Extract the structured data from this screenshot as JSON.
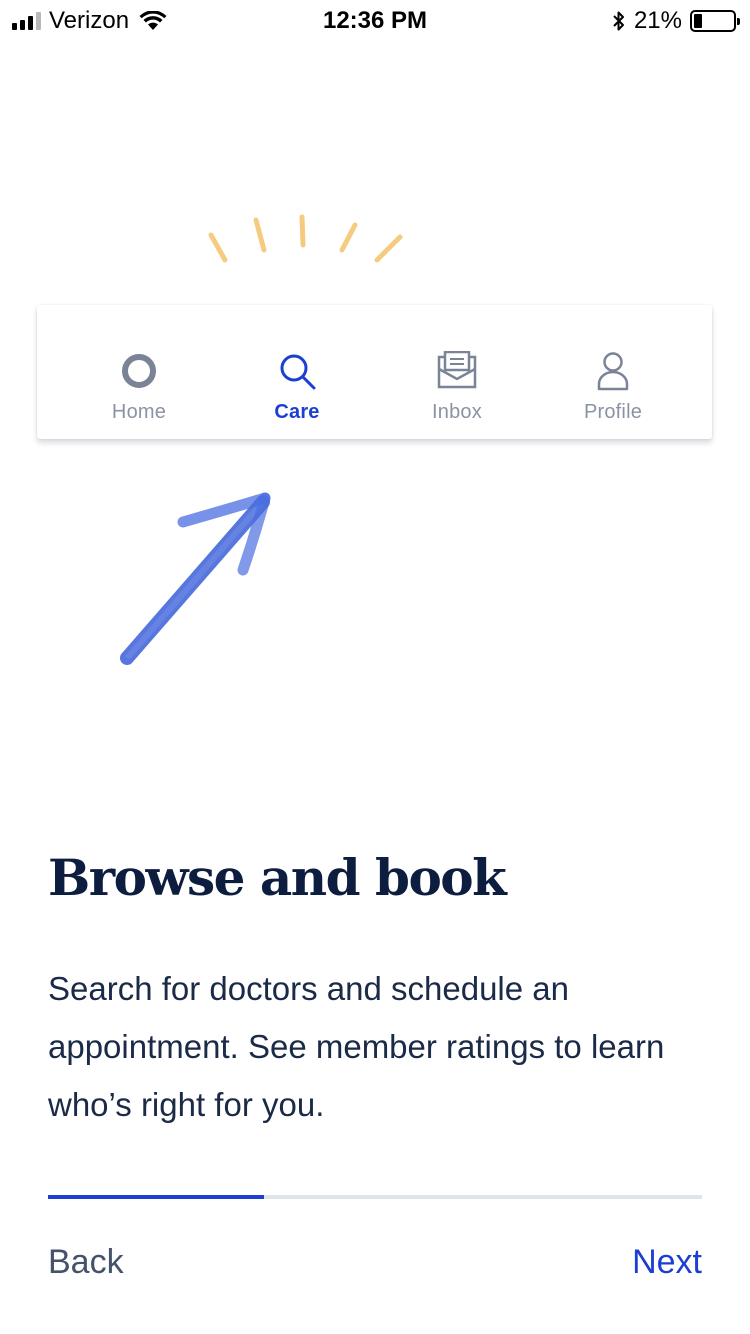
{
  "status_bar": {
    "carrier": "Verizon",
    "time": "12:36 PM",
    "battery_percent": "21%",
    "battery_level": 0.21,
    "icons": [
      "signal-icon",
      "wifi-icon",
      "bluetooth-icon",
      "battery-icon"
    ]
  },
  "illustration": {
    "tabs": [
      {
        "label": "Home",
        "icon": "home-ring-icon",
        "active": false
      },
      {
        "label": "Care",
        "icon": "search-icon",
        "active": true
      },
      {
        "label": "Inbox",
        "icon": "inbox-icon",
        "active": false
      },
      {
        "label": "Profile",
        "icon": "profile-icon",
        "active": false
      }
    ],
    "decorations": [
      "sparkle-lines",
      "hand-drawn-arrow"
    ]
  },
  "content": {
    "title": "Browse and book",
    "description": "Search for doctors and schedule an appointment. See member ratings to learn who’s right for you."
  },
  "progress": {
    "value": 0.33
  },
  "navigation": {
    "back_label": "Back",
    "next_label": "Next"
  },
  "colors": {
    "accent": "#1c3fd1",
    "title": "#0d1d3f",
    "body": "#1b2a47",
    "muted": "#8a93a3",
    "sparkle": "#f5c674",
    "arrow": "#3a5fd8"
  }
}
